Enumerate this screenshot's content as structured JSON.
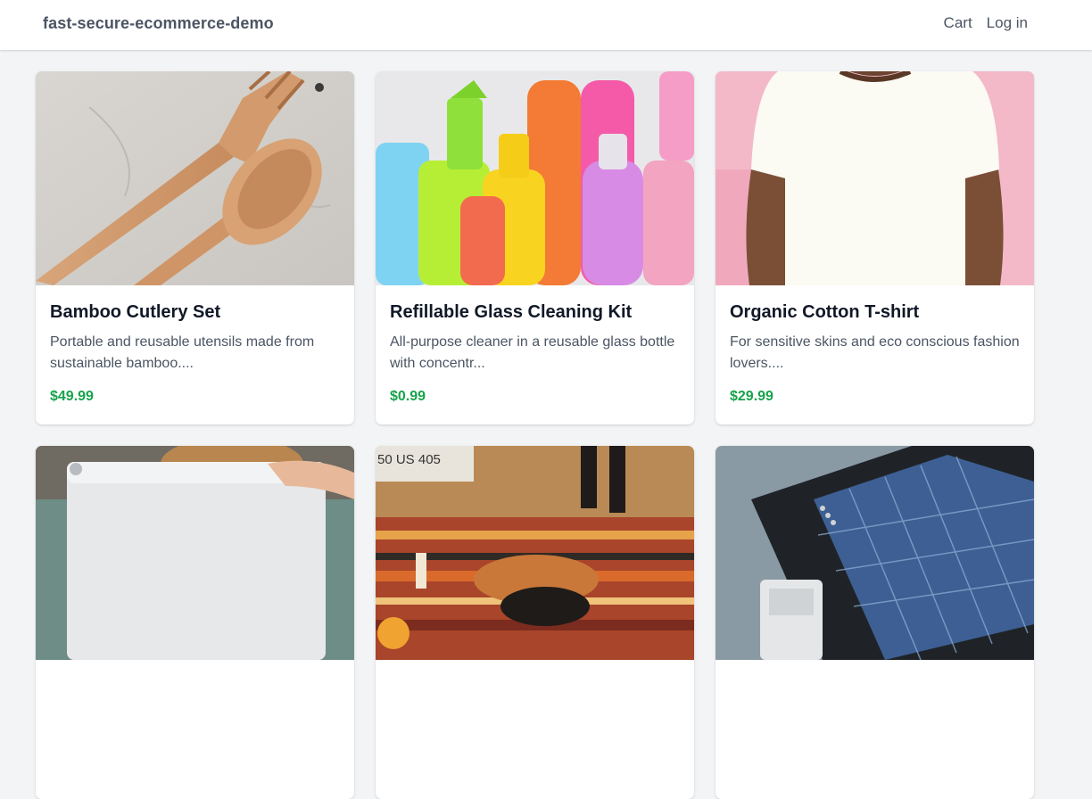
{
  "navbar": {
    "brand": "fast-secure-ecommerce-demo",
    "links": [
      {
        "label": "Cart"
      },
      {
        "label": "Log in"
      }
    ]
  },
  "products": [
    {
      "title": "Bamboo Cutlery Set",
      "description": "Portable and reusable utensils made from sustainable bamboo....",
      "price": "$49.99",
      "image": "bamboo-cutlery-photo"
    },
    {
      "title": "Refillable Glass Cleaning Kit",
      "description": "All-purpose cleaner in a reusable glass bottle with concentr...",
      "price": "$0.99",
      "image": "cleaning-bottles-photo"
    },
    {
      "title": "Organic Cotton T-shirt",
      "description": "For sensitive skins and eco conscious fashion lovers....",
      "price": "$29.99",
      "image": "white-tshirt-photo"
    },
    {
      "title": "",
      "description": "",
      "price": "",
      "image": "silicone-food-bag-photo"
    },
    {
      "title": "",
      "description": "",
      "price": "",
      "image": "picnic-blanket-photo",
      "image_text": "50 US 405"
    },
    {
      "title": "",
      "description": "",
      "price": "",
      "image": "solar-power-bank-photo"
    }
  ],
  "colors": {
    "price": "#16a34a",
    "text": "#4b5563",
    "background": "#f3f4f6"
  }
}
